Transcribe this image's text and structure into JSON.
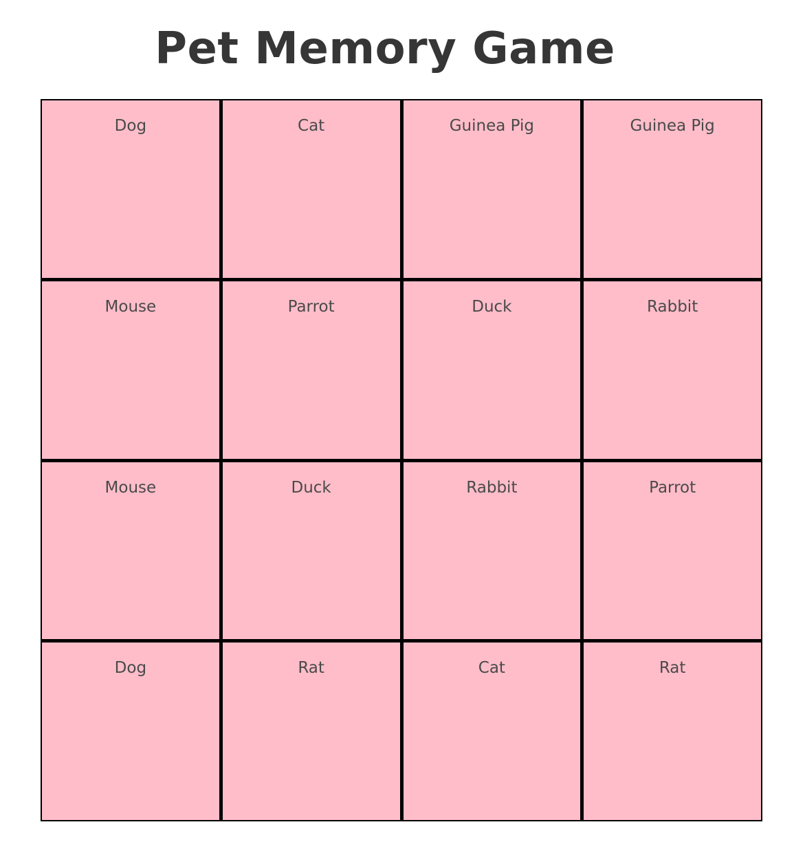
{
  "title": "Pet Memory Game",
  "colors": {
    "card_background": "#ffbdc9",
    "card_border": "#000000",
    "title_text": "#363636",
    "card_text": "#4a4a4a"
  },
  "board": {
    "rows": 4,
    "columns": 4,
    "cards": [
      "Dog",
      "Cat",
      "Guinea Pig",
      "Guinea Pig",
      "Mouse",
      "Parrot",
      "Duck",
      "Rabbit",
      "Mouse",
      "Duck",
      "Rabbit",
      "Parrot",
      "Dog",
      "Rat",
      "Cat",
      "Rat"
    ]
  }
}
